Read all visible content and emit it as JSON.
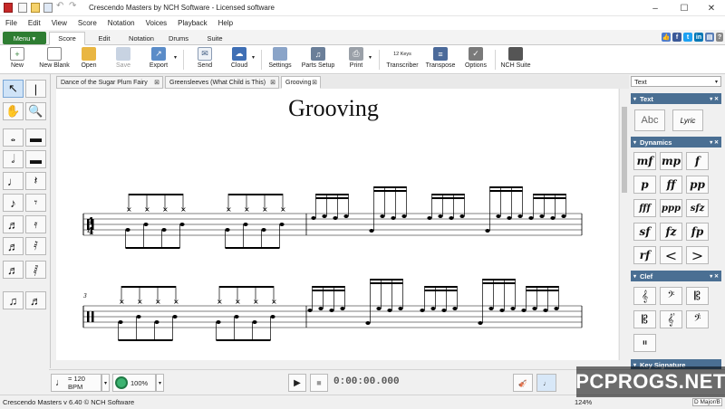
{
  "window": {
    "title": "Crescendo Masters by NCH Software - Licensed software",
    "minimize": "–",
    "maximize": "☐",
    "close": "✕"
  },
  "menubar": [
    "File",
    "Edit",
    "View",
    "Score",
    "Notation",
    "Voices",
    "Playback",
    "Help"
  ],
  "ribbon": {
    "menu_button": "Menu ▾",
    "tabs": [
      "Score",
      "Edit",
      "Notation",
      "Drums",
      "Suite"
    ],
    "active_tab": "Score"
  },
  "toolbar": {
    "buttons": [
      {
        "label": "New",
        "icon": "new-icon"
      },
      {
        "label": "New Blank",
        "icon": "new-blank-icon"
      },
      {
        "label": "Open",
        "icon": "open-icon"
      },
      {
        "label": "Save",
        "icon": "save-icon"
      },
      {
        "label": "Export",
        "icon": "export-icon"
      },
      {
        "label": "Send",
        "icon": "send-icon"
      },
      {
        "label": "Cloud",
        "icon": "cloud-icon"
      },
      {
        "label": "Settings",
        "icon": "settings-icon"
      },
      {
        "label": "Parts Setup",
        "icon": "parts-setup-icon"
      },
      {
        "label": "Print",
        "icon": "print-icon"
      },
      {
        "label": "Transcriber",
        "icon": "transcriber-icon"
      },
      {
        "label": "Transpose",
        "icon": "transpose-icon"
      },
      {
        "label": "Options",
        "icon": "options-icon"
      },
      {
        "label": "NCH Suite",
        "icon": "nch-suite-icon"
      }
    ],
    "transcriber_badge": "12 Keys"
  },
  "document_tabs": [
    {
      "label": "Dance of the Sugar Plum Fairy"
    },
    {
      "label": "Greensleeves (What Child is This)"
    },
    {
      "label": "Grooving"
    }
  ],
  "score": {
    "title": "Grooving",
    "time_signature": {
      "top": "4",
      "bottom": "4"
    },
    "measure_number": "3"
  },
  "right_panel": {
    "dropdown": "Text",
    "sections": [
      {
        "title": "Text",
        "items": [
          "Abc",
          "Lyric"
        ]
      },
      {
        "title": "Dynamics",
        "items": [
          "mf",
          "mp",
          "f",
          "p",
          "ff",
          "pp",
          "fff",
          "ppp",
          "sfz",
          "sf",
          "fz",
          "fp",
          "rf",
          "<",
          ">"
        ]
      },
      {
        "title": "Clef",
        "items": []
      },
      {
        "title": "Key Signature",
        "items": []
      }
    ]
  },
  "bottom": {
    "tempo": "= 120 BPM",
    "zoom_playback": "100%",
    "time": "0:00:00.000"
  },
  "statusbar": {
    "version": "Crescendo Masters v 6.40 © NCH Software",
    "zoom": "124%",
    "key_hint": "D Major/B"
  },
  "watermark": "PCPROGS.NET",
  "colors": {
    "accent": "#2e7d32",
    "panel_header": "#4a6f93"
  }
}
